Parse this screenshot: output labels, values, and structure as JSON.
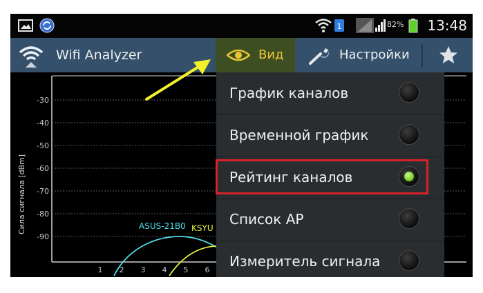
{
  "status_bar": {
    "time": "13:48",
    "battery": "82%",
    "icons": [
      "gallery-icon",
      "sync-icon",
      "wifi-icon",
      "sim-icon",
      "signal-icon",
      "signal-icon",
      "battery-icon"
    ]
  },
  "action_bar": {
    "title": "Wifi Analyzer",
    "view_label": "Вид",
    "settings_label": "Настройки",
    "star_icon": "star-icon"
  },
  "graph": {
    "ylabel": "Сила сигнала [dBm]",
    "y_ticks": [
      "-30",
      "-40",
      "-50",
      "-60",
      "-70",
      "-80",
      "-90"
    ],
    "x_ticks": [
      "1",
      "2",
      "3",
      "4",
      "5",
      "6"
    ],
    "networks": [
      {
        "name": "ASUS-21B0",
        "color": "#4fe0e8"
      },
      {
        "name": "KSYU",
        "color": "#e6ef3c"
      }
    ]
  },
  "menu": {
    "items": [
      {
        "label": "График каналов",
        "selected": false
      },
      {
        "label": "Временной график",
        "selected": false
      },
      {
        "label": "Рейтинг каналов",
        "selected": true
      },
      {
        "label": "Список AP",
        "selected": false
      },
      {
        "label": "Измеритель сигнала",
        "selected": false
      }
    ]
  },
  "colors": {
    "action_bar": "#34506a",
    "view_active": "#3d4f22",
    "view_text": "#eac534",
    "highlight": "#d8222b",
    "arrow": "#f4f12a",
    "radio_on": "#6bc41c"
  }
}
